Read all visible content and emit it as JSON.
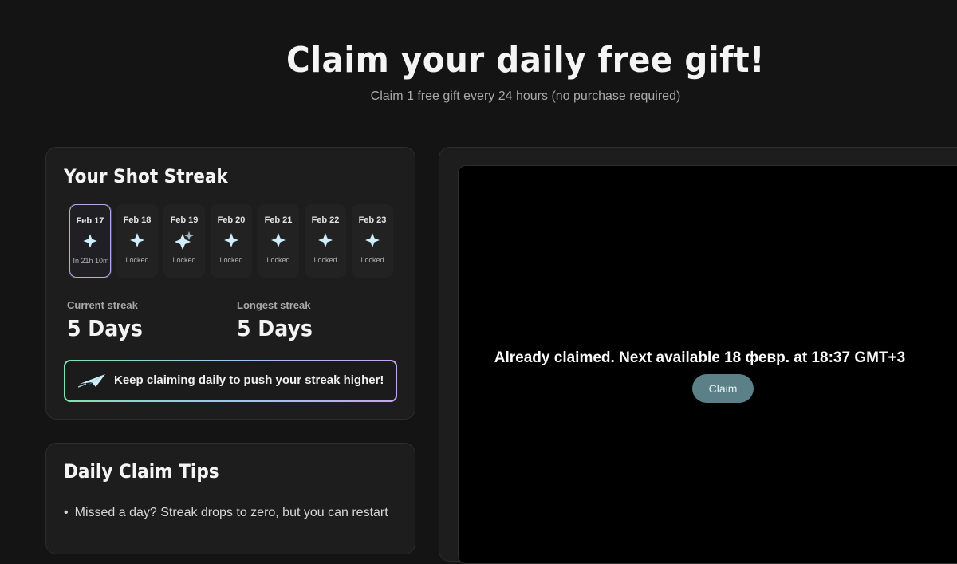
{
  "hero": {
    "title": "Claim your daily free gift!",
    "subtitle": "Claim 1 free gift every 24 hours (no purchase required)"
  },
  "streak": {
    "title": "Your Shot Streak",
    "days": [
      {
        "date": "Feb 17",
        "status": "In 21h 10m",
        "icon": "sparkle-icon",
        "active": true
      },
      {
        "date": "Feb 18",
        "status": "Locked",
        "icon": "sparkle-icon"
      },
      {
        "date": "Feb 19",
        "status": "Locked",
        "icon": "double-sparkle-icon"
      },
      {
        "date": "Feb 20",
        "status": "Locked",
        "icon": "sparkle-icon"
      },
      {
        "date": "Feb 21",
        "status": "Locked",
        "icon": "sparkle-icon"
      },
      {
        "date": "Feb 22",
        "status": "Locked",
        "icon": "sparkle-icon"
      },
      {
        "date": "Feb 23",
        "status": "Locked",
        "icon": "sparkle-icon"
      }
    ],
    "current_label": "Current streak",
    "current_value": "5 Days",
    "longest_label": "Longest streak",
    "longest_value": "5 Days",
    "banner_text": "Keep claiming daily to push your streak higher!",
    "banner_icon": "paper-plane-icon"
  },
  "tips": {
    "title": "Daily Claim Tips",
    "items": [
      "Missed a day? Streak drops to zero, but you can restart"
    ]
  },
  "claim": {
    "message": "Already claimed. Next available 18 февр. at 18:37 GMT+3",
    "button_label": "Claim"
  },
  "colors": {
    "background": "#141414",
    "card": "#1d1d1d",
    "sparkle": "#cfeefa",
    "claim_button": "#5b8088"
  }
}
